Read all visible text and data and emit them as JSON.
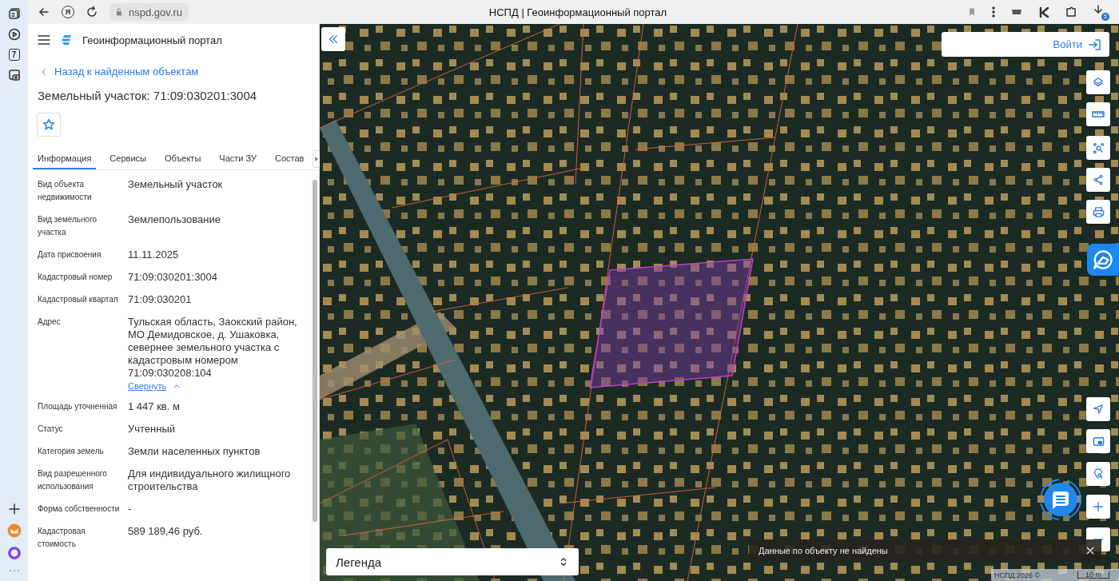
{
  "browser": {
    "calendar_day": "7",
    "yandex_key": "Я",
    "address": "nspd.gov.ru",
    "title": "НСПД | Геоинформационный портал",
    "downloads_badge": "5"
  },
  "portal": {
    "title": "Геоинформационный портал",
    "back_link": "Назад к найденным объектам",
    "heading": "Земельный участок: 71:09:030201:3004",
    "favorite": false
  },
  "tabs": [
    {
      "label": "Информация",
      "selected": true
    },
    {
      "label": "Сервисы",
      "selected": false
    },
    {
      "label": "Объекты",
      "selected": false
    },
    {
      "label": "Части ЗУ",
      "selected": false
    },
    {
      "label": "Состав",
      "selected": false
    }
  ],
  "properties": [
    {
      "label": "Вид объекта недвижимости",
      "value": "Земельный участок"
    },
    {
      "label": "Вид земельного участка",
      "value": "Землепользование"
    },
    {
      "label": "Дата присвоения",
      "value": "11.11.2025"
    },
    {
      "label": "Кадастровый номер",
      "value": "71:09:030201:3004"
    },
    {
      "label": "Кадастровый квартал",
      "value": "71:09:030201"
    },
    {
      "label": "Адрес",
      "value": "Тульская область, Заокский район, МО Демидовское, д. Ушаковка, севернее земельного участка с кадастровым номером 71:09:030208:104",
      "toggle": "Свернуть"
    },
    {
      "label": "Площадь уточненная",
      "value": "1 447 кв. м"
    },
    {
      "label": "Статус",
      "value": "Учтенный"
    },
    {
      "label": "Категория земель",
      "value": "Земли населенных пунктов"
    },
    {
      "label": "Вид разрешенного использования",
      "value": "Для индивидуального жилищного строительства"
    },
    {
      "label": "Форма собственности",
      "value": "-"
    },
    {
      "label": "Кадастровая стоимость",
      "value": "589 189,46 руб."
    }
  ],
  "map": {
    "login": "Войти",
    "legend": "Легенда",
    "toast": "Данные по объекту не найдены",
    "copyright": "НСПД 2026 ©",
    "scale": "10 m"
  }
}
